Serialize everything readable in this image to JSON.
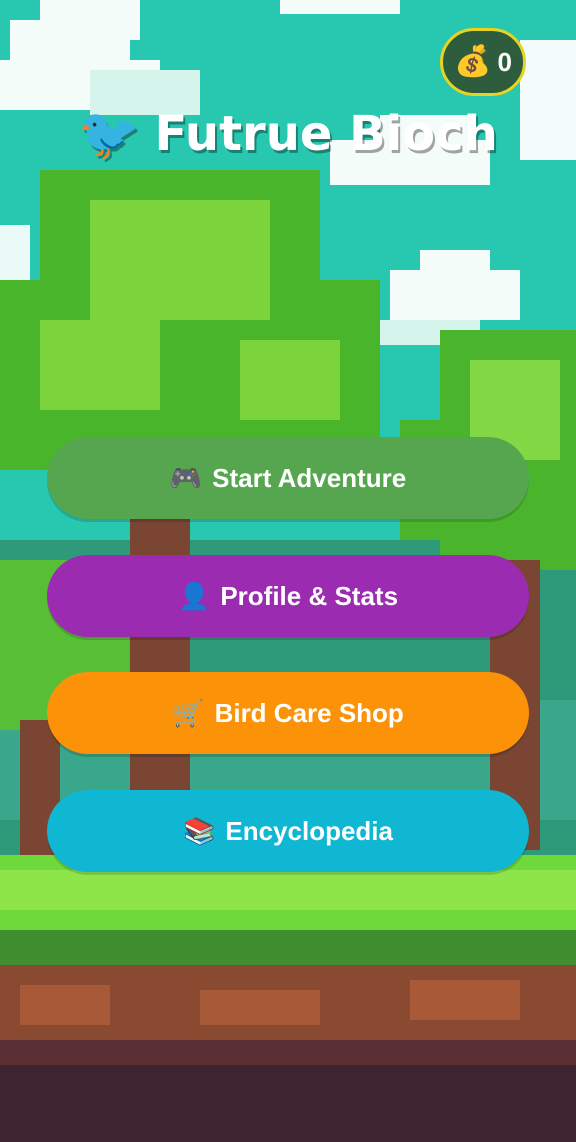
{
  "header": {
    "title": "Futrue Bioch",
    "title_icon": "bird-icon",
    "coins": "0",
    "coin_icon": "money-bag-icon"
  },
  "menu": {
    "buttons": [
      {
        "label": "Start Adventure",
        "icon": "🎮",
        "icon_name": "game-controller-icon",
        "color": "#56a64f"
      },
      {
        "label": "Profile & Stats",
        "icon": "👤",
        "icon_name": "user-icon",
        "color": "#9b2bb1"
      },
      {
        "label": "Bird Care Shop",
        "icon": "🛒",
        "icon_name": "shopping-cart-icon",
        "color": "#fb9208"
      },
      {
        "label": "Encyclopedia",
        "icon": "📚",
        "icon_name": "books-icon",
        "color": "#0fb7d3"
      }
    ]
  },
  "colors": {
    "sky": "#27c7b0",
    "foliage": "#6fd83a",
    "trunk": "#7a4633",
    "dirt": "#8a4a32",
    "coin_border": "#e7d321"
  }
}
